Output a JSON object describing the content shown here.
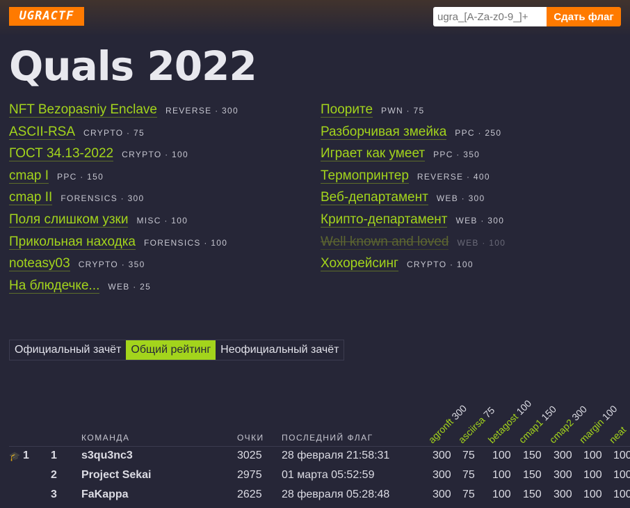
{
  "header": {
    "logo": "UGRACTF",
    "flag_placeholder": "ugra_[A-Za-z0-9_]+",
    "submit_label": "Сдать флаг"
  },
  "page_title": "Quals 2022",
  "tasks_left": [
    {
      "name": "NFT Bezopasniy Enclave",
      "meta": "REVERSE · 300"
    },
    {
      "name": "ASCII-RSA",
      "meta": "CRYPTO · 75"
    },
    {
      "name": "ГОСТ 34.13-2022",
      "meta": "CRYPTO · 100"
    },
    {
      "name": "cmap I",
      "meta": "PPC · 150"
    },
    {
      "name": "cmap II",
      "meta": "FORENSICS · 300"
    },
    {
      "name": "Поля слишком узки",
      "meta": "MISC · 100"
    },
    {
      "name": "Прикольная находка",
      "meta": "FORENSICS · 100"
    },
    {
      "name": "noteasy03",
      "meta": "CRYPTO · 350"
    },
    {
      "name": "На блюдечке...",
      "meta": "WEB · 25"
    }
  ],
  "tasks_right": [
    {
      "name": "Поорите",
      "meta": "PWN · 75"
    },
    {
      "name": "Разборчивая змейка",
      "meta": "PPC · 250"
    },
    {
      "name": "Играет как умеет",
      "meta": "PPC · 350"
    },
    {
      "name": "Термопринтер",
      "meta": "REVERSE · 400"
    },
    {
      "name": "Веб-департамент",
      "meta": "WEB · 300"
    },
    {
      "name": "Крипто-департамент",
      "meta": "WEB · 300"
    },
    {
      "name": "Well known and loved",
      "meta": "WEB · 100"
    },
    {
      "name": "Хохорейсинг",
      "meta": "CRYPTO · 100"
    }
  ],
  "tabs": [
    "Официальный зачёт",
    "Общий рейтинг",
    "Неофициальный зачёт"
  ],
  "active_tab": "Общий рейтинг",
  "table": {
    "headers": {
      "team": "КОМАНДА",
      "points": "ОЧКИ",
      "last_flag": "ПОСЛЕДНИЙ ФЛАГ"
    },
    "task_columns": [
      {
        "name": "agronft",
        "points": "300"
      },
      {
        "name": "asciirsa",
        "points": "75"
      },
      {
        "name": "betagost",
        "points": "100"
      },
      {
        "name": "cmap1",
        "points": "150"
      },
      {
        "name": "cmap2",
        "points": "300"
      },
      {
        "name": "margin",
        "points": "100"
      },
      {
        "name": "neat",
        "points": ""
      }
    ],
    "rows": [
      {
        "official_place": "1",
        "place": "1",
        "team": "s3qu3nc3",
        "points": "3025",
        "last_flag": "28 февраля 21:58:31",
        "scores": [
          "300",
          "75",
          "100",
          "150",
          "300",
          "100",
          "100"
        ]
      },
      {
        "official_place": "",
        "place": "2",
        "team": "Project Sekai",
        "points": "2975",
        "last_flag": "01 марта 05:52:59",
        "scores": [
          "300",
          "75",
          "100",
          "150",
          "300",
          "100",
          "100"
        ]
      },
      {
        "official_place": "",
        "place": "3",
        "team": "FaKappa",
        "points": "2625",
        "last_flag": "28 февраля 05:28:48",
        "scores": [
          "300",
          "75",
          "100",
          "150",
          "300",
          "100",
          "100"
        ]
      }
    ]
  }
}
